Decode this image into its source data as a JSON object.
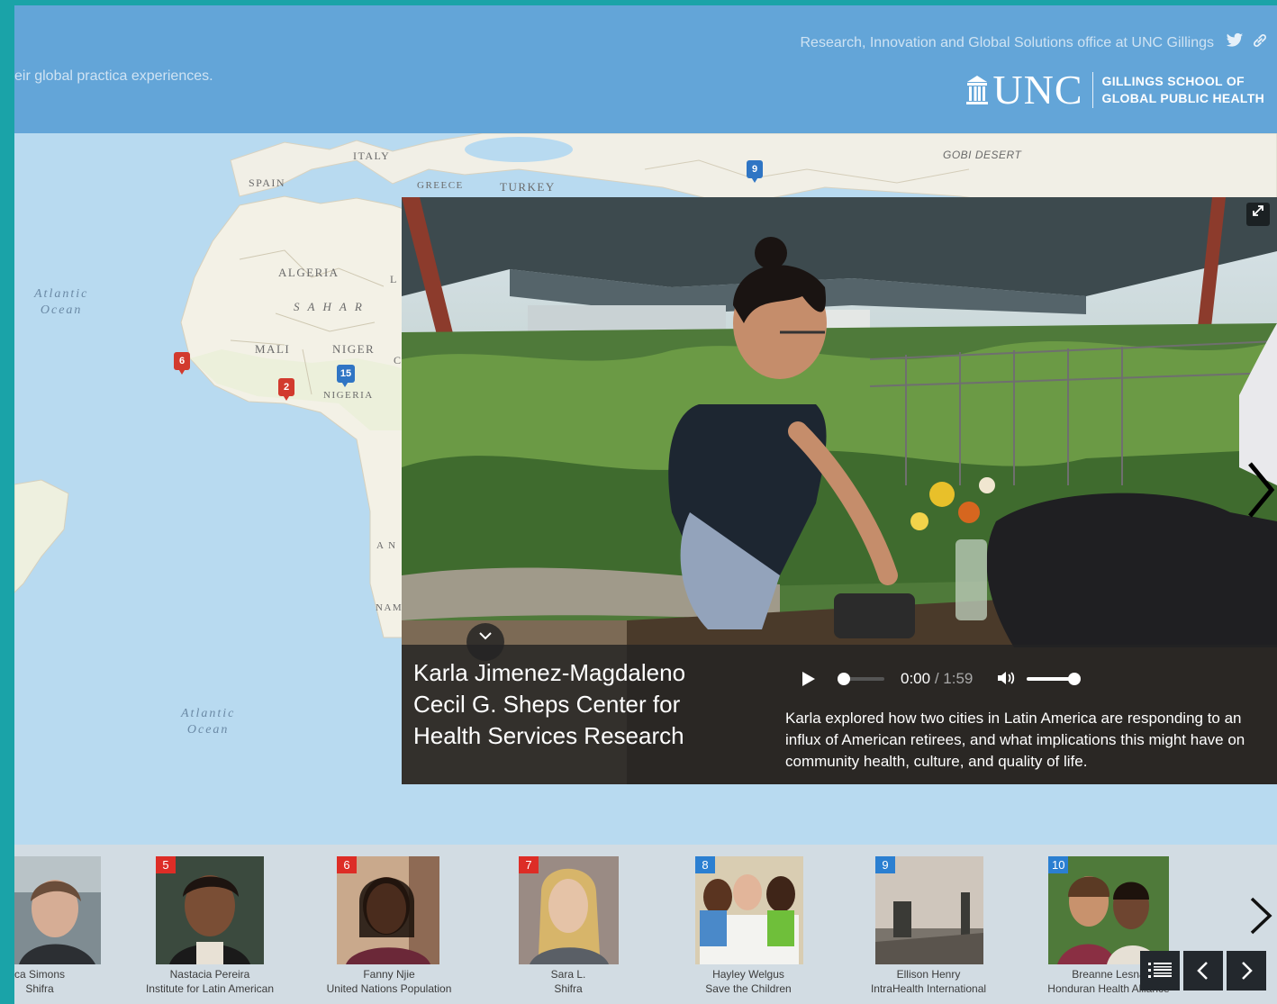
{
  "header": {
    "subtitle": "eir global practica experiences.",
    "org_link": "Research, Innovation and Global Solutions office at UNC Gillings",
    "logo_text": "UNC",
    "school_line1": "GILLINGS SCHOOL OF",
    "school_line2": "GLOBAL PUBLIC HEALTH"
  },
  "map": {
    "labels": {
      "spain": "SPAIN",
      "italy": "ITALY",
      "greece": "GREECE",
      "turkey": "TURKEY",
      "gobi": "GOBI DESERT",
      "algeria": "ALGERIA",
      "sahara": "S A H A R",
      "libya_l": "L",
      "mali": "MALI",
      "niger": "NIGER",
      "nigeria": "NIGERIA",
      "chad_c": "C",
      "angola_partial": "A N",
      "namibia_partial": "NAM",
      "ocean_north_1": "Atlantic",
      "ocean_north_2": "Ocean",
      "ocean_south_1": "Atlantic",
      "ocean_south_2": "Ocean"
    },
    "pins": [
      {
        "number": "6",
        "color": "red"
      },
      {
        "number": "2",
        "color": "red"
      },
      {
        "number": "15",
        "color": "blue"
      },
      {
        "number": "9",
        "color": "blue"
      }
    ]
  },
  "media": {
    "caption_line1": "Karla Jimenez-Magdaleno",
    "caption_line2": "Cecil G. Sheps Center for",
    "caption_line3": "Health Services Research",
    "time_current": "0:00",
    "time_sep": " / ",
    "time_total": "1:59",
    "progress": 0,
    "volume": 1,
    "description": "Karla explored how two cities in Latin America are responding to an influx of American retirees, and what implications this might have on community health, culture, and quality of life."
  },
  "carousel": {
    "items": [
      {
        "number": "",
        "color": "",
        "name": "ca Simons",
        "org": "Shifra"
      },
      {
        "number": "5",
        "color": "red",
        "name": "Nastacia Pereira",
        "org": "Institute for Latin American"
      },
      {
        "number": "6",
        "color": "red",
        "name": "Fanny Njie",
        "org": "United Nations Population"
      },
      {
        "number": "7",
        "color": "red",
        "name": "Sara L.",
        "org": "Shifra"
      },
      {
        "number": "8",
        "color": "blue",
        "name": "Hayley Welgus",
        "org": "Save the Children"
      },
      {
        "number": "9",
        "color": "blue",
        "name": "Ellison Henry",
        "org": "IntraHealth International"
      },
      {
        "number": "10",
        "color": "blue",
        "name": "Breanne Lesna",
        "org": "Honduran Health Alliance"
      }
    ]
  },
  "colors": {
    "header_bg": "#63a5d8",
    "frame_border": "#1aa3a8",
    "pin_red": "#d23a2e",
    "pin_blue": "#2f75c4",
    "carousel_bg": "#d2dce3"
  },
  "icons": {
    "twitter": "twitter-icon",
    "link": "link-icon",
    "expand": "expand-icon",
    "next": "chevron-right-icon",
    "collapse": "chevron-down-icon",
    "play": "play-icon",
    "volume": "volume-icon",
    "list": "list-icon",
    "prev": "chevron-left-icon"
  }
}
